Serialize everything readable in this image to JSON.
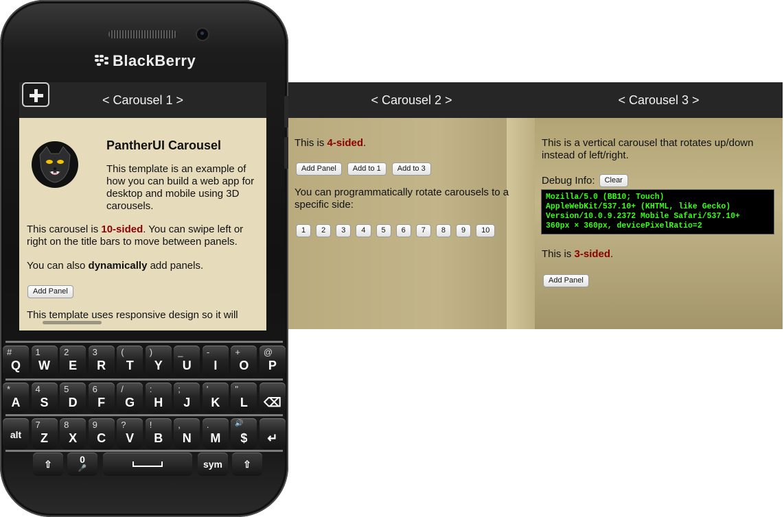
{
  "device": {
    "brand": "BlackBerry"
  },
  "panel1": {
    "title": "< Carousel 1 >",
    "heading": "PantherUI Carousel",
    "intro": "This template is an example of how you can build a web app for desktop and mobile using 3D carousels.",
    "sides_pre": "This carousel is ",
    "sides_value": "10-sided",
    "sides_post": ". You can swipe left or right on the title bars to move between panels.",
    "dyn_pre": "You can also ",
    "dyn_bold": "dynamically",
    "dyn_post": " add panels.",
    "add_panel": "Add Panel",
    "responsive": "This template uses responsive design so it will"
  },
  "panel2": {
    "title": "< Carousel 2 >",
    "is_pre": "This is ",
    "is_value": "4-sided",
    "is_post": ".",
    "buttons": [
      "Add Panel",
      "Add to 1",
      "Add to 3"
    ],
    "rotate_text": "You can programmatically rotate carousels to a specific side:",
    "sides": [
      "1",
      "2",
      "3",
      "4",
      "5",
      "6",
      "7",
      "8",
      "9",
      "10"
    ]
  },
  "panel3": {
    "title": "< Carousel 3 >",
    "desc": "This is a vertical carousel that rotates up/down instead of left/right.",
    "debug_label": "Debug Info:",
    "clear": "Clear",
    "debug_lines": [
      "Mozilla/5.0 (BB10; Touch)",
      "AppleWebKit/537.10+ (KHTML, like Gecko)",
      "Version/10.0.9.2372 Mobile Safari/537.10+",
      "360px × 360px, devicePixelRatio=2"
    ],
    "is_pre": "This is ",
    "is_value": "3-sided",
    "is_post": ".",
    "add_panel": "Add Panel"
  },
  "keyboard": {
    "row1": [
      [
        "#",
        "Q"
      ],
      [
        "1",
        "W"
      ],
      [
        "2",
        "E"
      ],
      [
        "3",
        "R"
      ],
      [
        "(",
        "T"
      ],
      [
        ")",
        "Y"
      ],
      [
        "_",
        "U"
      ],
      [
        "-",
        "I"
      ],
      [
        "+",
        "O"
      ],
      [
        "@",
        "P"
      ]
    ],
    "row2": [
      [
        "*",
        "A"
      ],
      [
        "4",
        "S"
      ],
      [
        "5",
        "D"
      ],
      [
        "6",
        "F"
      ],
      [
        "/",
        "G"
      ],
      [
        ":",
        "H"
      ],
      [
        ";",
        "J"
      ],
      [
        "'",
        "K"
      ],
      [
        "\"",
        "L"
      ],
      [
        "",
        "⌫"
      ]
    ],
    "row3": [
      [
        "",
        "alt"
      ],
      [
        "7",
        "Z"
      ],
      [
        "8",
        "X"
      ],
      [
        "9",
        "C"
      ],
      [
        "?",
        "V"
      ],
      [
        "!",
        "B"
      ],
      [
        ",",
        "N"
      ],
      [
        ".",
        "M"
      ],
      [
        "🔊",
        "$"
      ],
      [
        "",
        "↵"
      ]
    ],
    "bottom": [
      "⇧",
      "0",
      "🎤",
      "sym",
      "⇧"
    ]
  },
  "colors": {
    "titlebar": "#262626",
    "accent_red": "#8b0000",
    "debug_text": "#39ff14"
  }
}
